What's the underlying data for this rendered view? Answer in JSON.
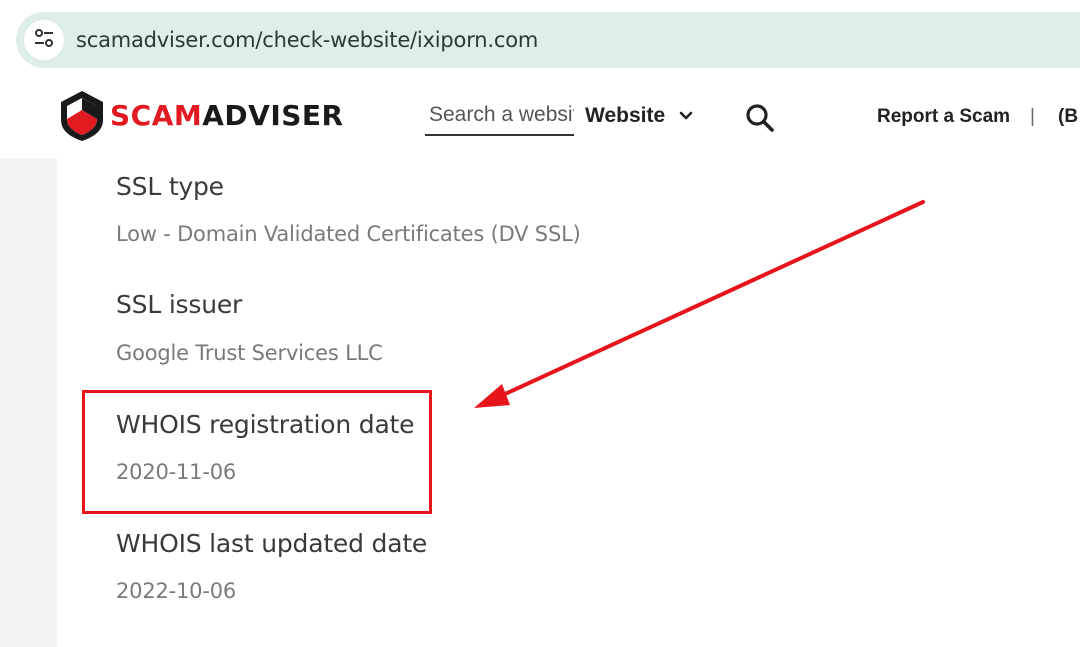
{
  "browser": {
    "url": "scamadviser.com/check-website/ixiporn.com",
    "site_info_icon": "tune-icon"
  },
  "header": {
    "logo": {
      "part1": "SCAM",
      "part2": "ADVISER"
    },
    "search_placeholder": "Search a website",
    "search_type": "Website",
    "report_link": "Report a Scam",
    "divider": "|",
    "extra_link": "(B"
  },
  "details": [
    {
      "label": "SSL type",
      "value": "Low - Domain Validated Certificates (DV SSL)"
    },
    {
      "label": "SSL issuer",
      "value": "Google Trust Services LLC"
    },
    {
      "label": "WHOIS registration date",
      "value": "2020-11-06"
    },
    {
      "label": "WHOIS last updated date",
      "value": "2022-10-06"
    }
  ],
  "colors": {
    "brand_red": "#e21b22",
    "annotation_red": "#e8141c",
    "omnibox_bg": "#deeee8"
  }
}
